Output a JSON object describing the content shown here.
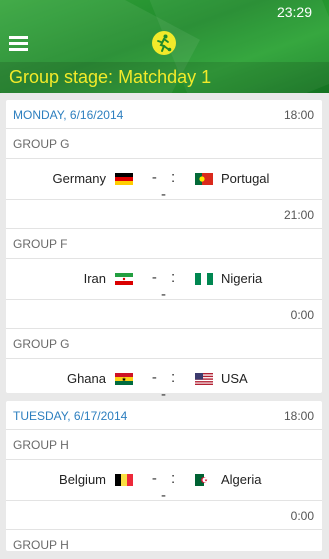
{
  "status_bar": {
    "time": "23:29"
  },
  "header": {
    "title": "Group stage: Matchday 1"
  },
  "days": [
    {
      "date": "MONDAY, 6/16/2014",
      "matches": [
        {
          "time": "18:00",
          "group": "GROUP G",
          "home": "Germany",
          "away": "Portugal",
          "score": "- : -"
        },
        {
          "time": "21:00",
          "group": "GROUP F",
          "home": "Iran",
          "away": "Nigeria",
          "score": "- : -"
        },
        {
          "time": "0:00",
          "group": "GROUP G",
          "home": "Ghana",
          "away": "USA",
          "score": "- : -"
        }
      ]
    },
    {
      "date": "TUESDAY, 6/17/2014",
      "matches": [
        {
          "time": "18:00",
          "group": "GROUP H",
          "home": "Belgium",
          "away": "Algeria",
          "score": "- : -"
        },
        {
          "time": "0:00",
          "group": "GROUP H"
        }
      ]
    }
  ],
  "colors": {
    "accent": "#f2ea2a",
    "header_green": "#1f8a2b",
    "date_blue": "#2d7fbf"
  },
  "icons": {
    "menu": "hamburger-menu-icon",
    "logo": "soccer-player-logo-icon"
  }
}
